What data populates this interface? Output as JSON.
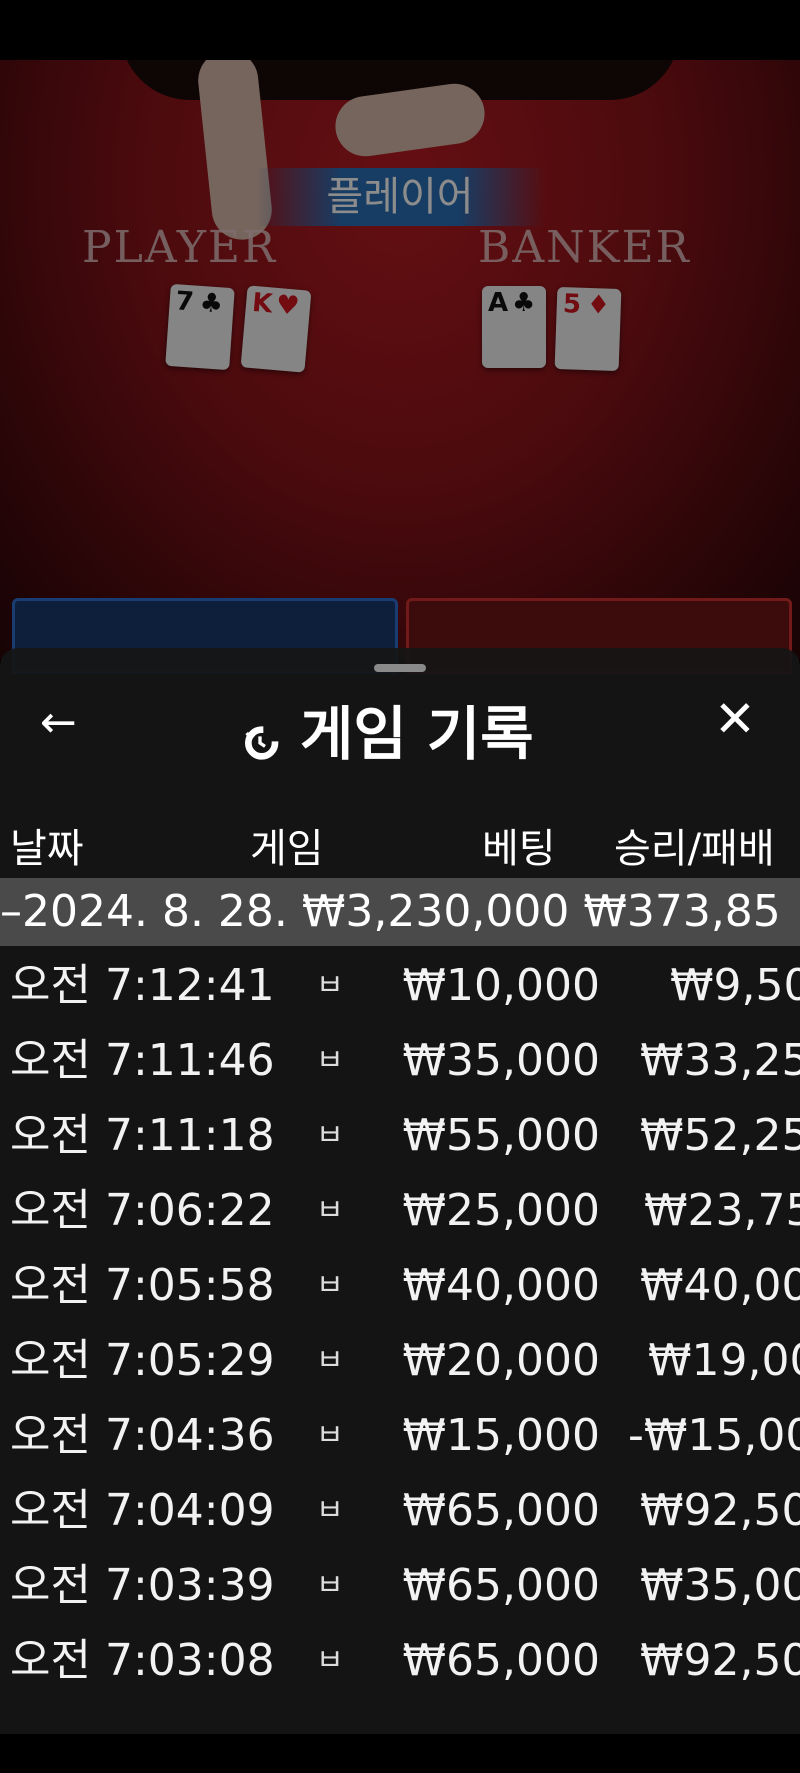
{
  "game_table": {
    "banner": "플레이어",
    "player_label": "PLAYER",
    "banker_label": "BANKER",
    "player_cards": [
      {
        "rank": "7",
        "suit": "♣",
        "color": "black"
      },
      {
        "rank": "K",
        "suit": "♥",
        "color": "red"
      }
    ],
    "banker_cards": [
      {
        "rank": "A",
        "suit": "♣",
        "color": "black"
      },
      {
        "rank": "5",
        "suit": "♦",
        "color": "red"
      }
    ]
  },
  "sheet": {
    "title": "게임 기록",
    "back_icon": "←",
    "close_icon": "✕",
    "columns": {
      "date": "날짜",
      "game": "게임",
      "bet": "베팅",
      "win_loss": "승리/패배"
    },
    "summary": {
      "date": "–2024. 8. 28.",
      "bet": "₩3,230,000",
      "win_loss": "₩373,85"
    },
    "rows": [
      {
        "time": "오전 7:12:41",
        "game": "ㅂ",
        "bet": "₩10,000",
        "win_loss": "₩9,50"
      },
      {
        "time": "오전 7:11:46",
        "game": "ㅂ",
        "bet": "₩35,000",
        "win_loss": "₩33,25"
      },
      {
        "time": "오전 7:11:18",
        "game": "ㅂ",
        "bet": "₩55,000",
        "win_loss": "₩52,25"
      },
      {
        "time": "오전 7:06:22",
        "game": "ㅂ",
        "bet": "₩25,000",
        "win_loss": "₩23,75"
      },
      {
        "time": "오전 7:05:58",
        "game": "ㅂ",
        "bet": "₩40,000",
        "win_loss": "₩40,00"
      },
      {
        "time": "오전 7:05:29",
        "game": "ㅂ",
        "bet": "₩20,000",
        "win_loss": "₩19,00"
      },
      {
        "time": "오전 7:04:36",
        "game": "ㅂ",
        "bet": "₩15,000",
        "win_loss": "-₩15,00"
      },
      {
        "time": "오전 7:04:09",
        "game": "ㅂ",
        "bet": "₩65,000",
        "win_loss": "₩92,50"
      },
      {
        "time": "오전 7:03:39",
        "game": "ㅂ",
        "bet": "₩65,000",
        "win_loss": "₩35,00"
      },
      {
        "time": "오전 7:03:08",
        "game": "ㅂ",
        "bet": "₩65,000",
        "win_loss": "₩92,50"
      }
    ]
  },
  "colors": {
    "felt": "#8a141a",
    "sheet_bg": "#161616",
    "summary_bg": "#4a4a4a",
    "player_blue": "#2e6fd0",
    "banker_red": "#d03030"
  }
}
